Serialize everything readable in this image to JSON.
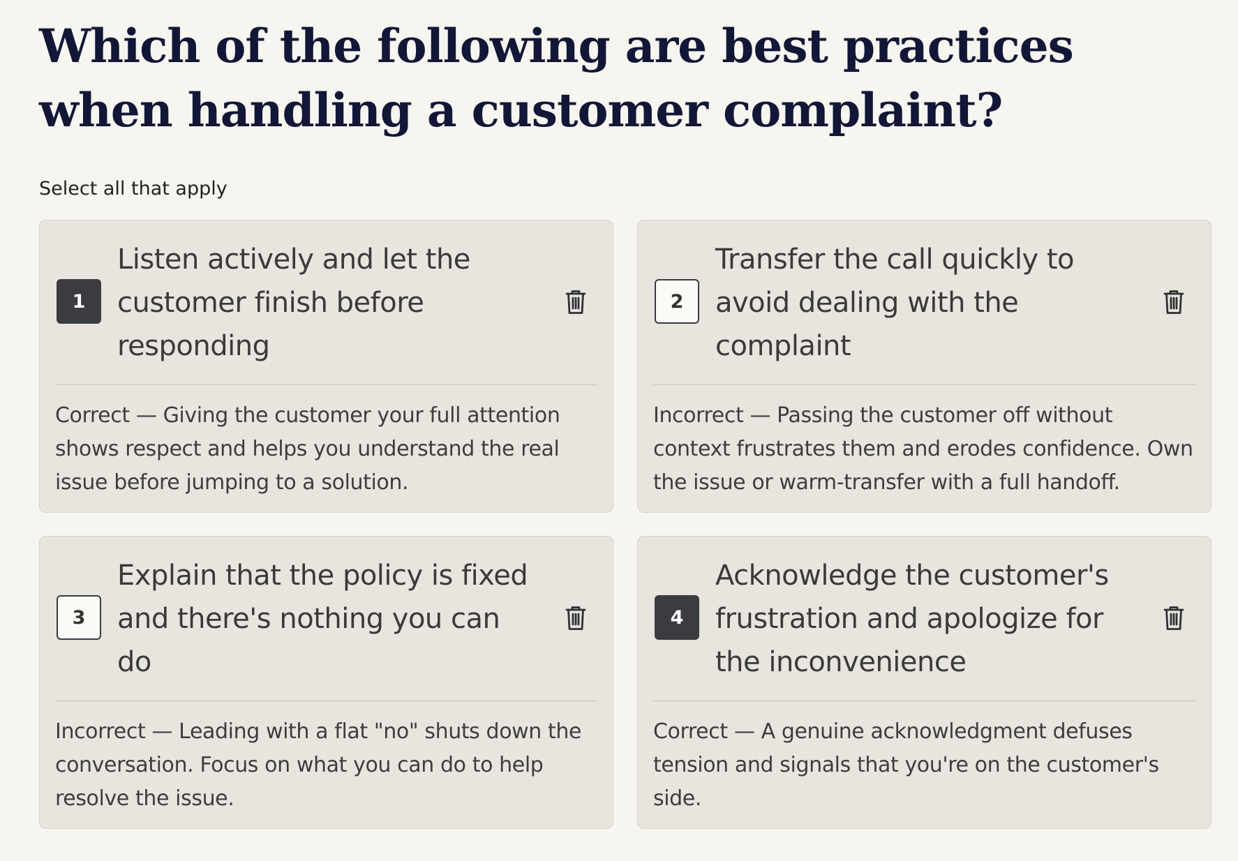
{
  "question": {
    "title": "Which of the following are best practices when handling a customer complaint?",
    "instruction": "Select all that apply"
  },
  "options": [
    {
      "number": "1",
      "text": "Listen actively and let the customer finish before responding",
      "selected": true,
      "feedback": "Correct — Giving the customer your full attention shows respect and helps you understand the real issue before jumping to a solution."
    },
    {
      "number": "2",
      "text": "Transfer the call quickly to avoid dealing with the complaint",
      "selected": false,
      "feedback": "Incorrect — Passing the customer off without context frustrates them and erodes confidence. Own the issue or warm-transfer with a full handoff."
    },
    {
      "number": "3",
      "text": "Explain that the policy is fixed and there's nothing you can do",
      "selected": false,
      "feedback": "Incorrect — Leading with a flat \"no\" shuts down the conversation. Focus on what you can do to help resolve the issue."
    },
    {
      "number": "4",
      "text": "Acknowledge the customer's frustration and apologize for the inconvenience",
      "selected": true,
      "feedback": "Correct — A genuine acknowledgment defuses tension and signals that you're on the customer's side."
    }
  ],
  "icons": {
    "delete": "trash-icon"
  },
  "colors": {
    "title": "#121737",
    "card_background": "#e8e5df",
    "selected_badge": "#3a3c40",
    "page_background": "#f7f5f0"
  }
}
